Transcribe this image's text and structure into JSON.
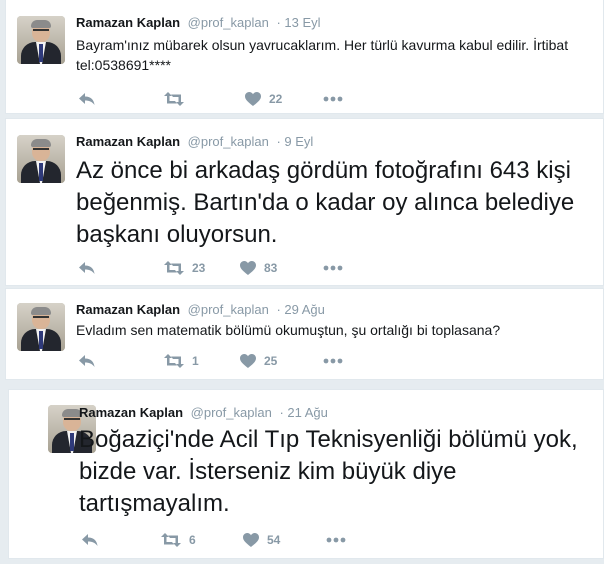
{
  "tweets": [
    {
      "name": "Ramazan Kaplan",
      "handle": "@prof_kaplan",
      "date": "· 13 Eyl",
      "text": "Bayram'ınız mübarek olsun yavrucaklarım. Her türlü kavurma kabul edilir. İrtibat tel:0538691****",
      "retweets": "",
      "likes": "22"
    },
    {
      "name": "Ramazan Kaplan",
      "handle": "@prof_kaplan",
      "date": "· 9 Eyl",
      "text": "Az önce bi arkadaş  gördüm fotoğrafını 643 kişi beğenmiş. Bartın'da o kadar oy alınca belediye başkanı oluyorsun.",
      "retweets": "23",
      "likes": "83"
    },
    {
      "name": "Ramazan Kaplan",
      "handle": "@prof_kaplan",
      "date": "· 29 Ağu",
      "text": "Evladım sen matematik bölümü okumuştun, şu ortalığı bi toplasana?",
      "retweets": "1",
      "likes": "25"
    },
    {
      "name": "Ramazan Kaplan",
      "handle": "@prof_kaplan",
      "date": "· 21 Ağu",
      "text": "Boğaziçi'nde Acil Tıp Teknisyenliği bölümü yok, bizde var. İsterseniz kim büyük diye tartışmayalım.",
      "retweets": "6",
      "likes": "54"
    }
  ],
  "icons": {
    "reply": "reply-icon",
    "retweet": "retweet-icon",
    "like": "heart-icon",
    "more": "more-icon"
  },
  "colors": {
    "icon": "#8899a6",
    "text": "#14171a",
    "border": "#e1e8ed",
    "background": "#e6ecf0"
  }
}
